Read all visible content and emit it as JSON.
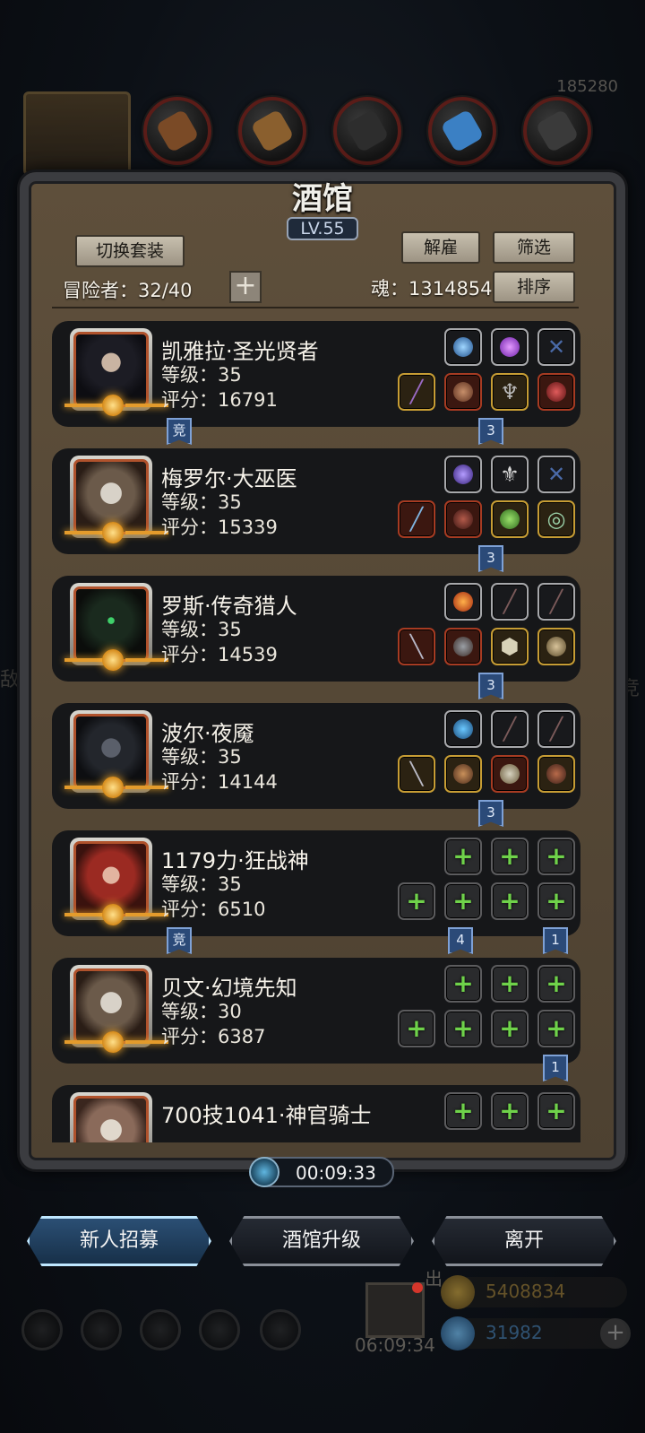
{
  "title": "酒馆",
  "level_badge": "LV.55",
  "top_right_number": "185280",
  "buttons": {
    "switch_set": "切换套装",
    "dismiss": "解雇",
    "filter": "筛选",
    "sort": "排序",
    "recruit": "新人招募",
    "upgrade": "酒馆升级",
    "leave": "离开"
  },
  "adventurers_label": "冒险者：32/40",
  "soul_label": "魂：1314854",
  "timer": "00:09:33",
  "heroes": [
    {
      "name": "凯雅拉·圣光贤者",
      "level": "等级：35",
      "score": "评分：16791",
      "tag_left": "竞",
      "tag_right": "3"
    },
    {
      "name": "梅罗尔·大巫医",
      "level": "等级：35",
      "score": "评分：15339",
      "tag_right": "3"
    },
    {
      "name": "罗斯·传奇猎人",
      "level": "等级：35",
      "score": "评分：14539",
      "tag_right": "3"
    },
    {
      "name": "波尔·夜魇",
      "level": "等级：35",
      "score": "评分：14144",
      "tag_right": "3"
    },
    {
      "name": "1179力·狂战神",
      "level": "等级：35",
      "score": "评分：6510",
      "tag_left": "竞",
      "tag_mid": "4",
      "tag_right": "1"
    },
    {
      "name": "贝文·幻境先知",
      "level": "等级：30",
      "score": "评分：6387",
      "tag_right": "1"
    },
    {
      "name": "700技1041·神官骑士"
    }
  ],
  "dock": {
    "gift_timer": "06:09:34",
    "gold": "5408834",
    "gems": "31982",
    "out_label": "出"
  },
  "colors": {
    "frame": "#3b3c40",
    "panel": "#5e4f3b",
    "card": "#161719",
    "tag": "#2b4a78",
    "plus_green": "#6fd24a",
    "active_button": "#2b4f74"
  }
}
